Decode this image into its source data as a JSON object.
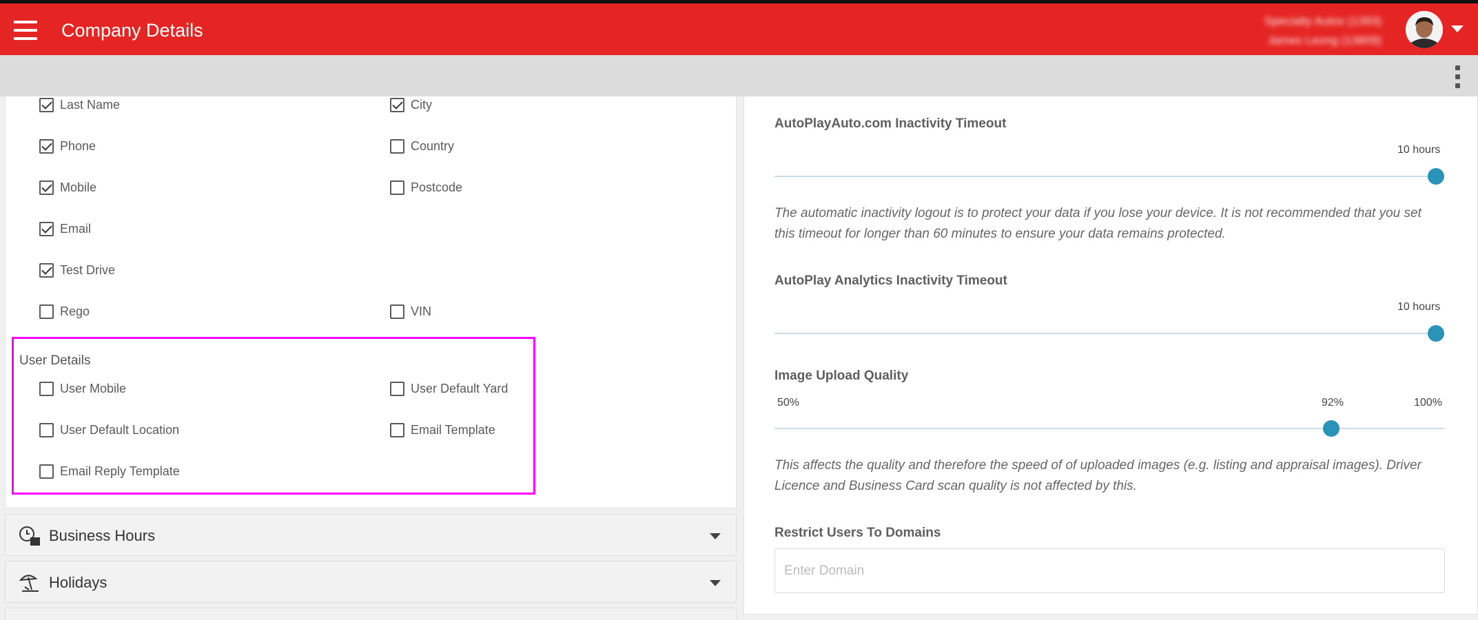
{
  "header": {
    "title": "Company Details",
    "user_line1": "Specialty Autos (1393)",
    "user_line2": "James Leong (13809)"
  },
  "contact_fields": {
    "left": [
      {
        "label": "Last Name",
        "checked": true
      },
      {
        "label": "Phone",
        "checked": true
      },
      {
        "label": "Mobile",
        "checked": true
      },
      {
        "label": "Email",
        "checked": true
      },
      {
        "label": "Test Drive",
        "checked": true
      },
      {
        "label": "Rego",
        "checked": false
      }
    ],
    "right": [
      {
        "label": "City",
        "checked": true
      },
      {
        "label": "Country",
        "checked": false
      },
      {
        "label": "Postcode",
        "checked": false
      },
      {
        "label": "VIN",
        "checked": false
      }
    ]
  },
  "user_details": {
    "title": "User Details",
    "items": [
      {
        "label": "User Mobile",
        "checked": false
      },
      {
        "label": "User Default Yard",
        "checked": false
      },
      {
        "label": "User Default Location",
        "checked": false
      },
      {
        "label": "Email Template",
        "checked": false
      },
      {
        "label": "Email Reply Template",
        "checked": false
      }
    ]
  },
  "accordions": [
    {
      "label": "Business Hours",
      "icon": "clock-calendar-icon"
    },
    {
      "label": "Holidays",
      "icon": "beach-umbrella-icon"
    }
  ],
  "settings": {
    "autoplay_timeout": {
      "title": "AutoPlayAuto.com Inactivity Timeout",
      "value_label": "10 hours",
      "level": 1.0
    },
    "timeout_note": "The automatic inactivity logout is to protect your data if you lose your device. It is not recommended that you set this timeout for longer than 60 minutes to ensure your data remains protected.",
    "analytics_timeout": {
      "title": "AutoPlay Analytics Inactivity Timeout",
      "value_label": "10 hours",
      "level": 1.0
    },
    "image_quality": {
      "title": "Image Upload Quality",
      "min_label": "50%",
      "value_label": "92%",
      "max_label": "100%",
      "value": 92
    },
    "quality_note": "This affects the quality and therefore the speed of of uploaded images (e.g. listing and appraisal images). Driver Licence and Business Card scan quality is not affected by this.",
    "restrict_domains": {
      "title": "Restrict Users To Domains",
      "placeholder": "Enter Domain",
      "value": ""
    }
  },
  "colors": {
    "brand": "#e52523",
    "slider": "#2a93b8",
    "highlight": "#ff00ff"
  }
}
